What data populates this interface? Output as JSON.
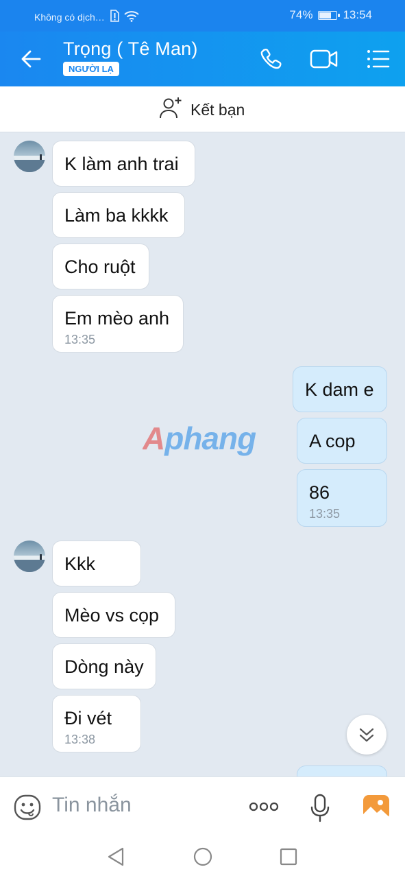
{
  "status_bar": {
    "carrier": "Không có dịch…",
    "battery": "74%",
    "battery_level": 0.74,
    "time": "13:54"
  },
  "header": {
    "title": "Trọng ( Tê Man)",
    "badge": "NGƯỜI LẠ",
    "back_icon": "arrow-left-icon",
    "call_icon": "phone-icon",
    "video_icon": "video-icon",
    "menu_icon": "list-icon"
  },
  "add_friend": {
    "label": "Kết bạn",
    "icon": "add-user-icon"
  },
  "messages": [
    {
      "text": "K làm anh trai",
      "from": "them"
    },
    {
      "text": "Làm ba kkkk",
      "from": "them"
    },
    {
      "text": "Cho ruột",
      "from": "them"
    },
    {
      "text": "Em mèo anh",
      "time": "13:35",
      "from": "them"
    },
    {
      "text": "K dam e",
      "from": "me"
    },
    {
      "text": "A cop",
      "from": "me"
    },
    {
      "text": "86",
      "time": "13:35",
      "from": "me"
    },
    {
      "text": "Kkk",
      "from": "them"
    },
    {
      "text": "Mèo vs cọp",
      "from": "them"
    },
    {
      "text": "Dòng này",
      "from": "them"
    },
    {
      "text": "Đi vét",
      "time": "13:38",
      "from": "them"
    }
  ],
  "watermark": "Aphang",
  "input": {
    "placeholder": "Tin nhắn",
    "emoji_icon": "emoji-icon",
    "more_icon": "more-dots-icon",
    "mic_icon": "microphone-icon",
    "image_icon": "image-icon"
  },
  "colors": {
    "header": "#1a87f0",
    "bubble_me": "#d5ecfc",
    "background": "#e2e9f1"
  }
}
